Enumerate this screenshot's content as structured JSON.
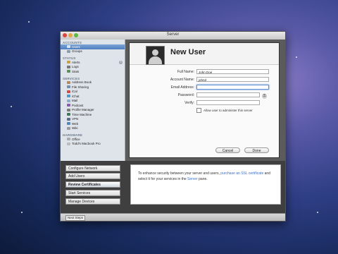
{
  "window": {
    "title": "Server"
  },
  "sidebar": {
    "sections": [
      {
        "title": "ACCOUNTS",
        "items": [
          {
            "label": "Users",
            "selected": true,
            "icon": "users-icon"
          },
          {
            "label": "Groups",
            "icon": "groups-icon"
          }
        ]
      },
      {
        "title": "STATUS",
        "items": [
          {
            "label": "Alerts",
            "icon": "alerts-icon",
            "badge": "3"
          },
          {
            "label": "Logs",
            "icon": "logs-icon"
          },
          {
            "label": "Stats",
            "icon": "stats-icon"
          }
        ]
      },
      {
        "title": "SERVICES",
        "items": [
          {
            "label": "Address Book",
            "icon": "address-book-icon"
          },
          {
            "label": "File Sharing",
            "icon": "file-sharing-icon"
          },
          {
            "label": "iCal",
            "icon": "ical-icon"
          },
          {
            "label": "iChat",
            "icon": "ichat-icon"
          },
          {
            "label": "Mail",
            "icon": "mail-icon"
          },
          {
            "label": "Podcast",
            "icon": "podcast-icon"
          },
          {
            "label": "Profile Manager",
            "icon": "profile-manager-icon"
          },
          {
            "label": "Time Machine",
            "icon": "time-machine-icon"
          },
          {
            "label": "VPN",
            "icon": "vpn-icon"
          },
          {
            "label": "Web",
            "icon": "web-icon"
          },
          {
            "label": "Wiki",
            "icon": "wiki-icon"
          }
        ]
      },
      {
        "title": "HARDWARE",
        "items": [
          {
            "label": "Office",
            "icon": "office-icon"
          },
          {
            "label": "Todd's Macbook Pro",
            "icon": "macbook-icon"
          }
        ]
      }
    ]
  },
  "new_user": {
    "title": "New User",
    "fields": {
      "full_name": {
        "label": "Full Name:",
        "value": "John Doe"
      },
      "account_name": {
        "label": "Account Name:",
        "value": "johnd"
      },
      "email": {
        "label": "Email Address:",
        "value": ""
      },
      "password": {
        "label": "Password:",
        "value": ""
      },
      "verify": {
        "label": "Verify:",
        "value": ""
      }
    },
    "checkbox_label": "Allow user to administer this server",
    "cancel_label": "Cancel",
    "done_label": "Done"
  },
  "actions": {
    "configure_network": "Configure Network",
    "add_users": "Add Users",
    "review_certificates": "Review Certificates",
    "start_services": "Start Services",
    "manage_devices": "Manage Devices"
  },
  "info": {
    "text_1": "To enhance security between your server and users, ",
    "link_1": "purchase an SSL certificate",
    "text_2": " and select it for your services in the ",
    "link_2": "Server",
    "text_3": " pane."
  },
  "statusbar": {
    "next_steps": "Next Steps"
  },
  "colors": {
    "accent": "#4f7fbf",
    "link": "#3b6fc7"
  }
}
